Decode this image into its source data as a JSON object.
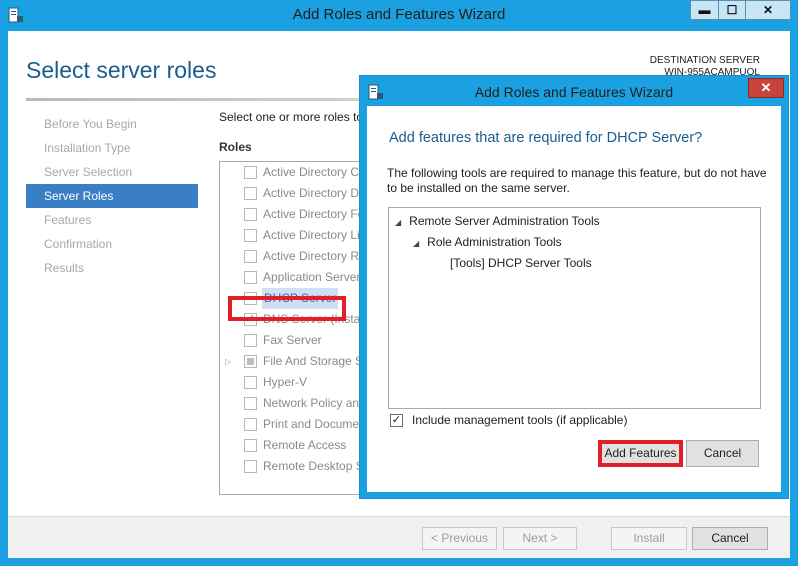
{
  "main_window": {
    "title": "Add Roles and Features Wizard",
    "controls": {
      "minimize": "▬",
      "maximize": "☐",
      "close": "✕"
    },
    "page_title": "Select server roles",
    "destination_label": "DESTINATION SERVER",
    "destination_name": "WIN-955ACAMPUOL",
    "steps": [
      {
        "label": "Before You Begin",
        "state": "disabled"
      },
      {
        "label": "Installation Type",
        "state": "disabled"
      },
      {
        "label": "Server Selection",
        "state": "disabled"
      },
      {
        "label": "Server Roles",
        "state": "active"
      },
      {
        "label": "Features",
        "state": "disabled"
      },
      {
        "label": "Confirmation",
        "state": "disabled"
      },
      {
        "label": "Results",
        "state": "disabled"
      }
    ],
    "instruction": "Select one or more roles to",
    "roles_heading": "Roles",
    "roles": [
      {
        "label": "Active Directory C",
        "checked": false
      },
      {
        "label": "Active Directory D",
        "checked": false
      },
      {
        "label": "Active Directory Fe",
        "checked": false
      },
      {
        "label": "Active Directory Li",
        "checked": false
      },
      {
        "label": "Active Directory R",
        "checked": false
      },
      {
        "label": "Application Server",
        "checked": false
      },
      {
        "label": "DHCP Server",
        "checked": false,
        "selected": true
      },
      {
        "label": "DNS Server (Instal",
        "checked": true
      },
      {
        "label": "Fax Server",
        "checked": false
      },
      {
        "label": "File And Storage S",
        "checked": "partial",
        "expandable": true
      },
      {
        "label": "Hyper-V",
        "checked": false
      },
      {
        "label": "Network Policy an",
        "checked": false
      },
      {
        "label": "Print and Docume",
        "checked": false
      },
      {
        "label": "Remote Access",
        "checked": false
      },
      {
        "label": "Remote Desktop S",
        "checked": false
      }
    ],
    "footer": {
      "previous": "< Previous",
      "next": "Next >",
      "install": "Install",
      "cancel": "Cancel"
    }
  },
  "dialog": {
    "title": "Add Roles and Features Wizard",
    "close_glyph": "✕",
    "heading": "Add features that are required for DHCP Server?",
    "description": "The following tools are required to manage this feature, but do not have to be installed on the same server.",
    "tree": [
      {
        "label": "Remote Server Administration Tools",
        "level": 1,
        "expanded": true
      },
      {
        "label": "Role Administration Tools",
        "level": 2,
        "expanded": true
      },
      {
        "label": "[Tools] DHCP Server Tools",
        "level": 3
      }
    ],
    "include_tools_label": "Include management tools (if applicable)",
    "include_tools_checked": true,
    "add_features_label": "Add Features",
    "cancel_label": "Cancel"
  },
  "colors": {
    "accent": "#1ba1e2",
    "title_text": "#1a5d8e",
    "active_step": "#3a7fc5",
    "highlight": "#e01f2b"
  },
  "glyphs": {
    "expanded": "◢",
    "collapsed": "▷",
    "check": "✓"
  }
}
